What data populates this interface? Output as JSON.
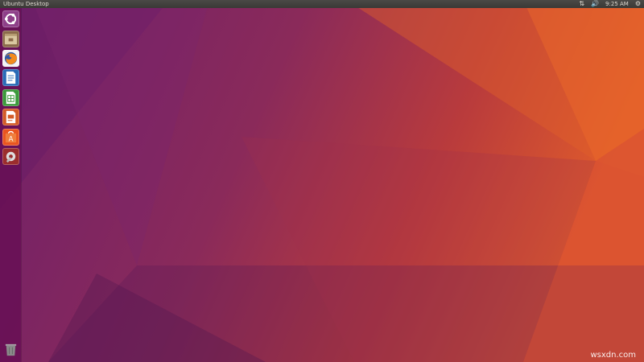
{
  "top_panel": {
    "title": "Ubuntu Desktop",
    "indicators": {
      "network_icon": "network-icon",
      "volume_icon": "volume-icon",
      "time": "9:25 AM",
      "system_icon": "gear-icon"
    }
  },
  "launcher": {
    "items": [
      {
        "icon": "ubuntu-dash-icon"
      },
      {
        "icon": "files-icon"
      },
      {
        "icon": "firefox-icon"
      },
      {
        "icon": "libreoffice-writer-icon"
      },
      {
        "icon": "libreoffice-calc-icon"
      },
      {
        "icon": "libreoffice-impress-icon"
      },
      {
        "icon": "ubuntu-software-icon"
      },
      {
        "icon": "system-settings-icon"
      },
      {
        "icon": "trash-icon"
      }
    ]
  },
  "watermark": "wsxdn.com",
  "colors": {
    "panel": "#3c3b37",
    "launcher": "#670f55",
    "wallpaper_purple": "#77216f",
    "wallpaper_orange": "#e95420"
  }
}
